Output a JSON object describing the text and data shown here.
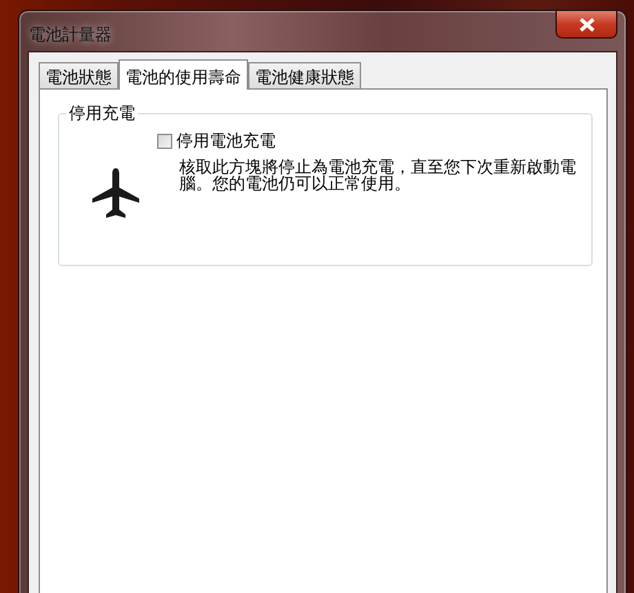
{
  "window": {
    "title": "電池計量器"
  },
  "tabs": [
    {
      "label": "電池狀態",
      "selected": false
    },
    {
      "label": "電池的使用壽命",
      "selected": true
    },
    {
      "label": "電池健康狀態",
      "selected": false
    }
  ],
  "group": {
    "title": "停用充電",
    "checkbox": {
      "label": "停用電池充電",
      "checked": false
    },
    "description": "核取此方塊將停止為電池充電，直至您下次重新啟動電腦。您的電池仍可以正常使用。"
  }
}
